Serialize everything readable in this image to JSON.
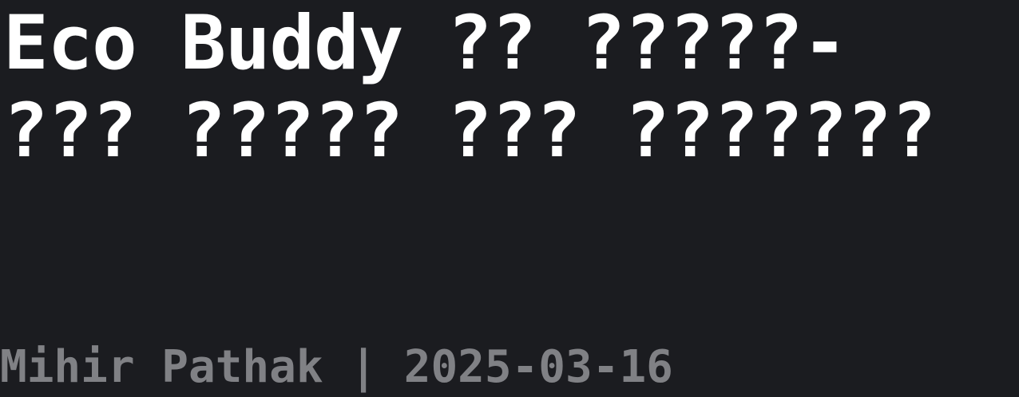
{
  "post": {
    "title": "Eco Buddy ?? ?????- ??? ????? ??? ???????",
    "author": "Mihir Pathak",
    "separator": "|",
    "date": "2025-03-16"
  },
  "colors": {
    "background": "#1b1c20",
    "title": "#ffffff",
    "byline": "#808185"
  }
}
